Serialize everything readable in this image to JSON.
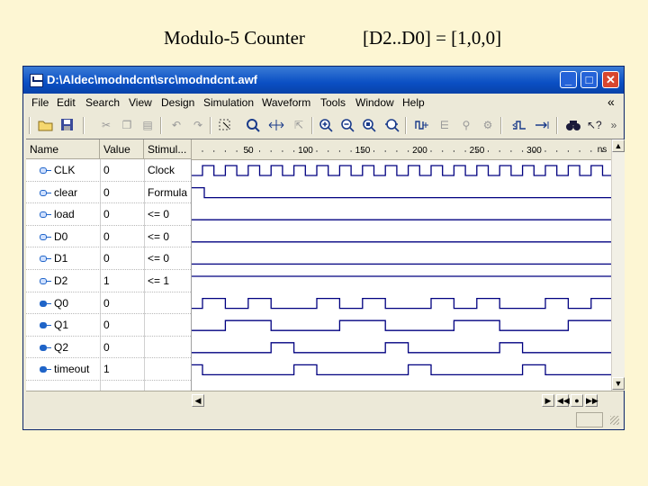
{
  "slide": {
    "title": "Modulo-5 Counter",
    "subtitle": "[D2..D0] = [1,0,0]"
  },
  "window": {
    "title": "D:\\Aldec\\modndcnt\\src\\modndcnt.awf",
    "controls": {
      "minimize": "_",
      "maximize": "□",
      "close": "✕"
    }
  },
  "menu": {
    "items": [
      "File",
      "Edit",
      "Search",
      "View",
      "Design",
      "Simulation",
      "Waveform",
      "Tools",
      "Window",
      "Help"
    ],
    "collapse": "«"
  },
  "toolbar": {
    "overflow": "»",
    "icons": [
      "open-folder-icon",
      "save-icon",
      "cut-icon",
      "copy-icon",
      "paste-icon",
      "undo-icon",
      "redo-icon",
      "select-icon",
      "search-icon",
      "measure-icon",
      "pointer-icon",
      "zoom-in-icon",
      "zoom-out-icon",
      "zoom-fit-icon",
      "zoom-all-icon",
      "add-signal-icon",
      "bus-icon",
      "signal-b-icon",
      "signal-c-icon",
      "edge-prev-icon",
      "edge-next-icon",
      "find-icon",
      "help-pointer-icon"
    ]
  },
  "columns": {
    "name": "Name",
    "value": "Value",
    "stimulator": "Stimul..."
  },
  "signals": [
    {
      "name": "CLK",
      "value": "0",
      "stimulator": "Clock",
      "type": "input"
    },
    {
      "name": "clear",
      "value": "0",
      "stimulator": "Formula",
      "type": "input"
    },
    {
      "name": "load",
      "value": "0",
      "stimulator": "<= 0",
      "type": "input"
    },
    {
      "name": "D0",
      "value": "0",
      "stimulator": "<= 0",
      "type": "input"
    },
    {
      "name": "D1",
      "value": "0",
      "stimulator": "<= 0",
      "type": "input"
    },
    {
      "name": "D2",
      "value": "1",
      "stimulator": "<= 1",
      "type": "input"
    },
    {
      "name": "Q0",
      "value": "0",
      "stimulator": "",
      "type": "output"
    },
    {
      "name": "Q1",
      "value": "0",
      "stimulator": "",
      "type": "output"
    },
    {
      "name": "Q2",
      "value": "0",
      "stimulator": "",
      "type": "output"
    },
    {
      "name": "timeout",
      "value": "1",
      "stimulator": "",
      "type": "output"
    }
  ],
  "ruler": {
    "labels": [
      "50",
      "100",
      "150",
      "200",
      "250",
      "300"
    ],
    "unit": "ns"
  },
  "colors": {
    "titlebar": "#0a4fc4",
    "waveform": "#000080",
    "background": "#fdf6d3"
  }
}
